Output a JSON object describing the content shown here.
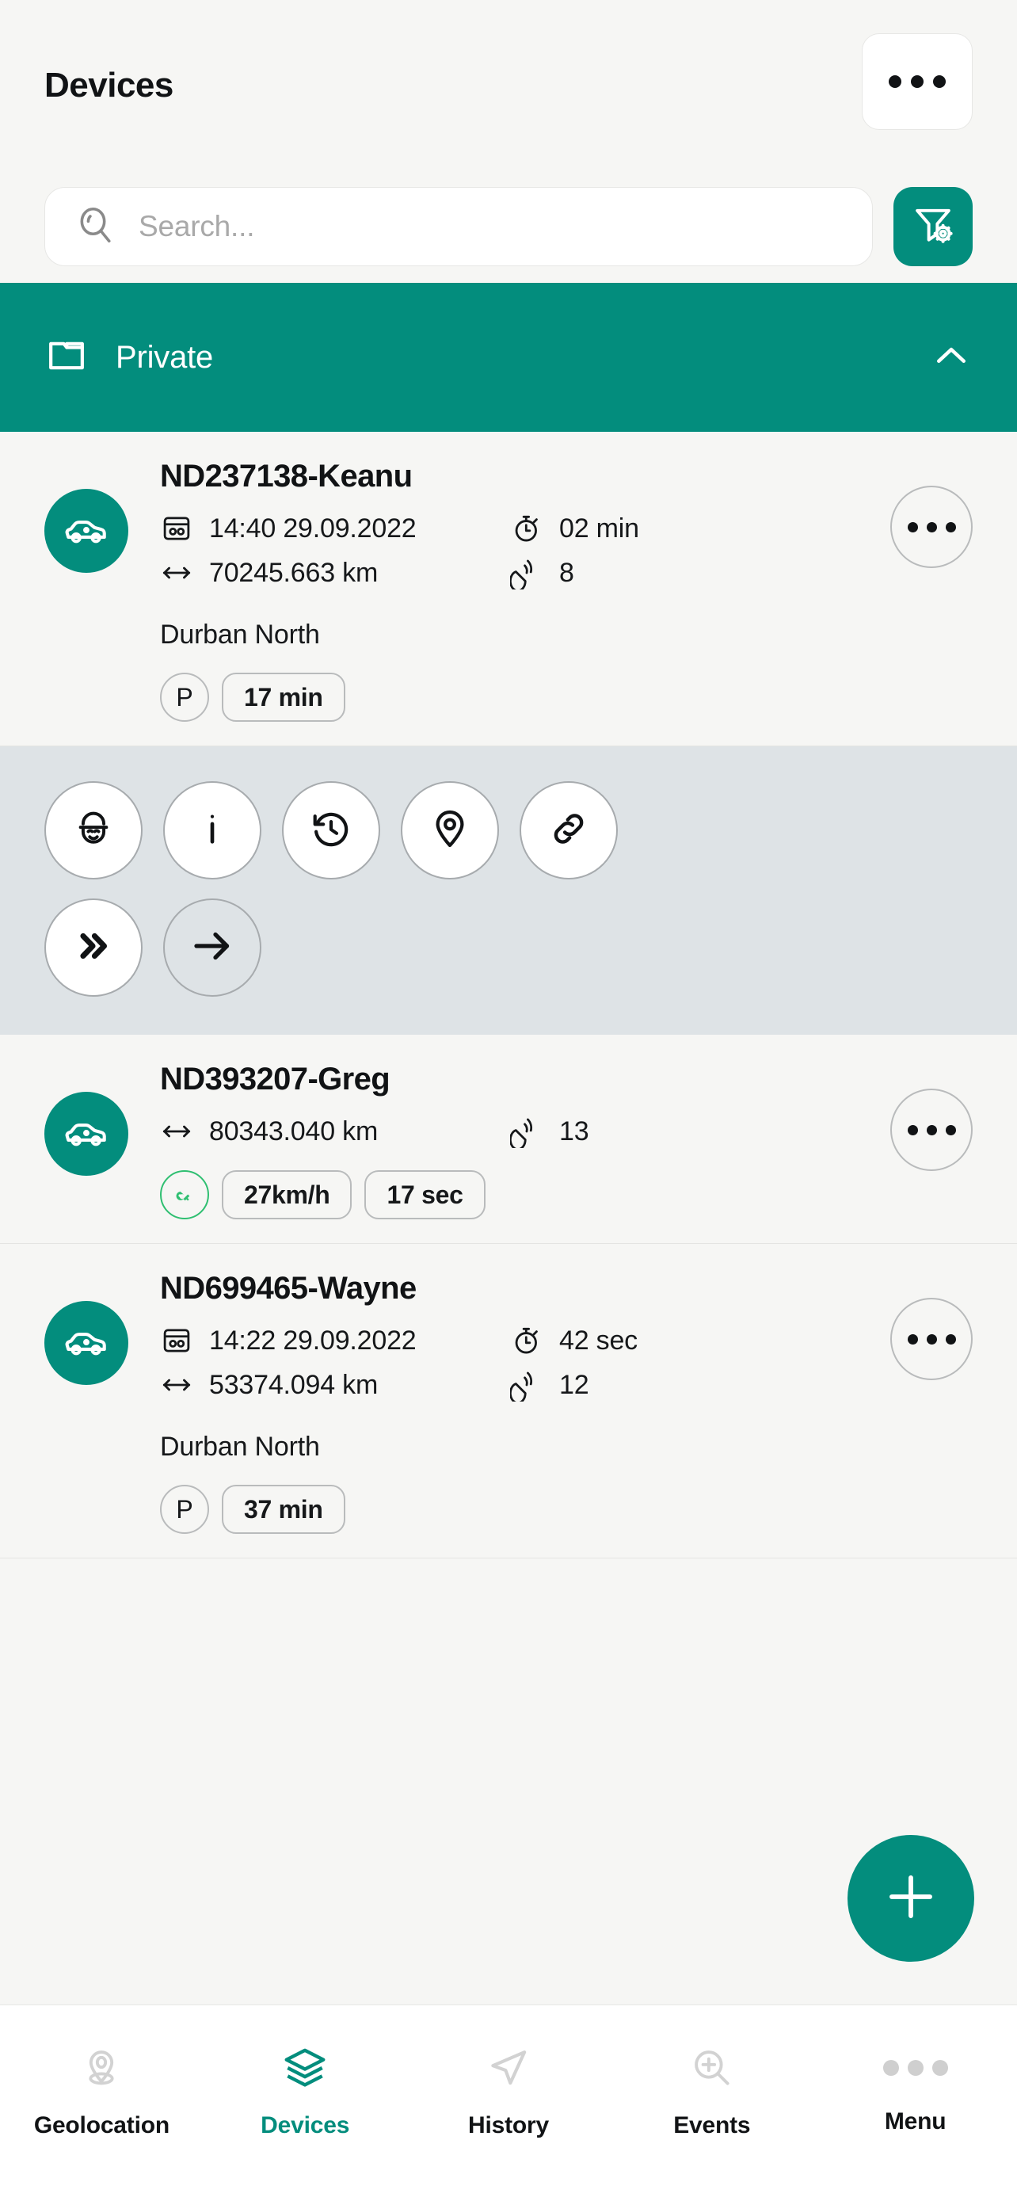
{
  "header": {
    "title": "Devices",
    "more_icon": "more-horizontal-icon"
  },
  "search": {
    "placeholder": "Search...",
    "value": "",
    "icon": "search-icon",
    "filter_icon": "filter-settings-icon"
  },
  "folder": {
    "label": "Private",
    "icon": "folder-icon",
    "collapse_icon": "chevron-up-icon",
    "expanded": true
  },
  "colors": {
    "accent": "#038d7d",
    "panel": "#dee3e6",
    "page_bg": "#f6f6f4",
    "key_green": "#2fbf71",
    "text": "#111315",
    "muted": "#a9a9a9"
  },
  "devices": [
    {
      "name": "ND237138-Keanu",
      "avatar_icon": "car-icon",
      "more_icon": "more-horizontal-icon",
      "stats": [
        {
          "icon": "odometer-icon",
          "value": "14:40 29.09.2022"
        },
        {
          "icon": "stopwatch-icon",
          "value": "02 min"
        },
        {
          "icon": "distance-arrows-icon",
          "value": "70245.663 km"
        },
        {
          "icon": "satellite-icon",
          "value": "8"
        }
      ],
      "location": "Durban North",
      "badges": [
        {
          "type": "circle",
          "icon": "parking-icon",
          "label": "P"
        },
        {
          "type": "pill",
          "label": "17 min"
        }
      ],
      "expanded": true
    },
    {
      "name": "ND393207-Greg",
      "avatar_icon": "car-icon",
      "more_icon": "more-horizontal-icon",
      "stats": [
        {
          "icon": "distance-arrows-icon",
          "value": "80343.040 km"
        },
        {
          "icon": "satellite-icon",
          "value": "13"
        }
      ],
      "location": "",
      "badges": [
        {
          "type": "circle",
          "icon": "ignition-key-icon",
          "label": ""
        },
        {
          "type": "pill",
          "label": "27km/h"
        },
        {
          "type": "pill",
          "label": "17 sec"
        }
      ],
      "expanded": false
    },
    {
      "name": "ND699465-Wayne",
      "avatar_icon": "car-icon",
      "more_icon": "more-horizontal-icon",
      "stats": [
        {
          "icon": "odometer-icon",
          "value": "14:22 29.09.2022"
        },
        {
          "icon": "stopwatch-icon",
          "value": "42 sec"
        },
        {
          "icon": "distance-arrows-icon",
          "value": "53374.094 km"
        },
        {
          "icon": "satellite-icon",
          "value": "12"
        }
      ],
      "location": "Durban North",
      "badges": [
        {
          "type": "circle",
          "icon": "parking-icon",
          "label": "P"
        },
        {
          "type": "pill",
          "label": "37 min"
        }
      ],
      "expanded": false
    }
  ],
  "action_panel": {
    "row1": [
      {
        "icon": "driver-icon"
      },
      {
        "icon": "info-icon"
      },
      {
        "icon": "history-clock-icon"
      },
      {
        "icon": "map-pin-icon"
      },
      {
        "icon": "link-icon"
      }
    ],
    "row2": [
      {
        "icon": "double-chevron-right-icon"
      },
      {
        "icon": "arrow-right-icon"
      }
    ]
  },
  "fab": {
    "icon": "plus-icon"
  },
  "bottom_nav": {
    "active": "Devices",
    "items": [
      {
        "label": "Geolocation",
        "icon": "map-pin-base-icon"
      },
      {
        "label": "Devices",
        "icon": "layers-icon"
      },
      {
        "label": "History",
        "icon": "navigation-arrow-icon"
      },
      {
        "label": "Events",
        "icon": "zoom-in-icon"
      },
      {
        "label": "Menu",
        "icon": "more-horizontal-icon"
      }
    ]
  }
}
